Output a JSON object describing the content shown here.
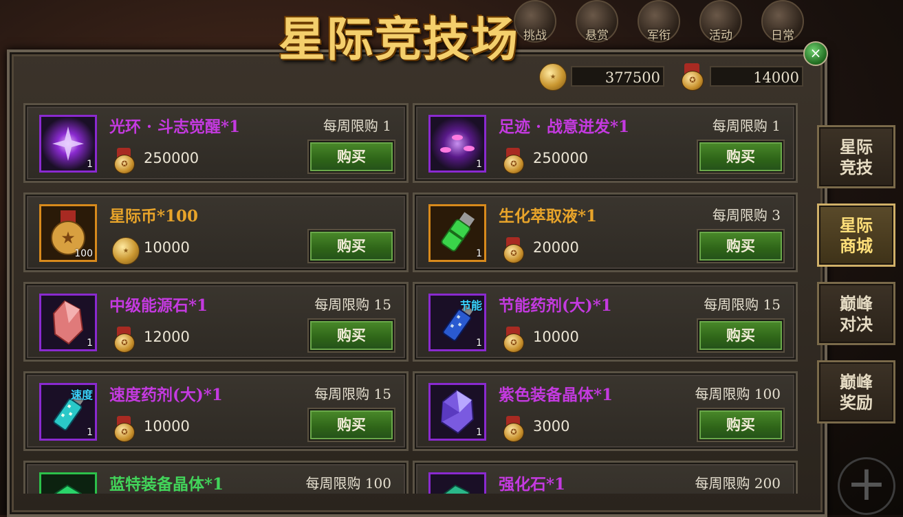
{
  "title": "星际竞技场",
  "background_nav": [
    {
      "label": "挑战",
      "icon": "challenge-icon"
    },
    {
      "label": "悬赏",
      "icon": "bounty-icon"
    },
    {
      "label": "军衔",
      "icon": "rank-icon"
    },
    {
      "label": "活动",
      "icon": "event-icon"
    },
    {
      "label": "日常",
      "icon": "daily-icon"
    }
  ],
  "currencies": [
    {
      "icon": "gold-coin-icon",
      "value": "377500"
    },
    {
      "icon": "star-medal-icon",
      "value": "14000"
    }
  ],
  "close_label": "×",
  "side_tabs": [
    {
      "line1": "星际",
      "line2": "竞技",
      "active": false
    },
    {
      "line1": "星际",
      "line2": "商城",
      "active": true
    },
    {
      "line1": "巅峰",
      "line2": "对决",
      "active": false
    },
    {
      "line1": "巅峰",
      "line2": "奖励",
      "active": false
    }
  ],
  "buy_label": "购买",
  "items": [
    {
      "name": "光环 · 斗志觉醒*1",
      "limit": "每周限购 1",
      "price": "250000",
      "currency": "star-medal",
      "qty": "1",
      "rarity": "purple",
      "icon": "aura-icon",
      "tag": ""
    },
    {
      "name": "足迹 · 战意迸发*1",
      "limit": "每周限购 1",
      "price": "250000",
      "currency": "star-medal",
      "qty": "1",
      "rarity": "purple",
      "icon": "footprint-icon",
      "tag": ""
    },
    {
      "name": "星际币*100",
      "limit": "",
      "price": "10000",
      "currency": "gold-coin",
      "qty": "100",
      "rarity": "orange",
      "icon": "star-coin-icon",
      "tag": ""
    },
    {
      "name": "生化萃取液*1",
      "limit": "每周限购 3",
      "price": "20000",
      "currency": "star-medal",
      "qty": "1",
      "rarity": "orange",
      "icon": "bio-extract-icon",
      "tag": ""
    },
    {
      "name": "中级能源石*1",
      "limit": "每周限购 15",
      "price": "12000",
      "currency": "star-medal",
      "qty": "1",
      "rarity": "purple",
      "icon": "energy-stone-icon",
      "tag": ""
    },
    {
      "name": "节能药剂(大)*1",
      "limit": "每周限购 15",
      "price": "10000",
      "currency": "star-medal",
      "qty": "1",
      "rarity": "purple",
      "icon": "potion-icon",
      "tag": "节能"
    },
    {
      "name": "速度药剂(大)*1",
      "limit": "每周限购 15",
      "price": "10000",
      "currency": "star-medal",
      "qty": "1",
      "rarity": "purple",
      "icon": "potion-icon",
      "tag": "速度"
    },
    {
      "name": "紫色装备晶体*1",
      "limit": "每周限购 100",
      "price": "3000",
      "currency": "star-medal",
      "qty": "1",
      "rarity": "purple",
      "icon": "purple-crystal-icon",
      "tag": ""
    },
    {
      "name": "蓝特装备晶体*1",
      "limit": "每周限购 100",
      "price": "",
      "currency": "star-medal",
      "qty": "",
      "rarity": "green",
      "icon": "green-crystal-icon",
      "tag": ""
    },
    {
      "name": "强化石*1",
      "limit": "每周限购 200",
      "price": "",
      "currency": "star-medal",
      "qty": "",
      "rarity": "purple",
      "icon": "enhance-stone-icon",
      "tag": ""
    }
  ]
}
